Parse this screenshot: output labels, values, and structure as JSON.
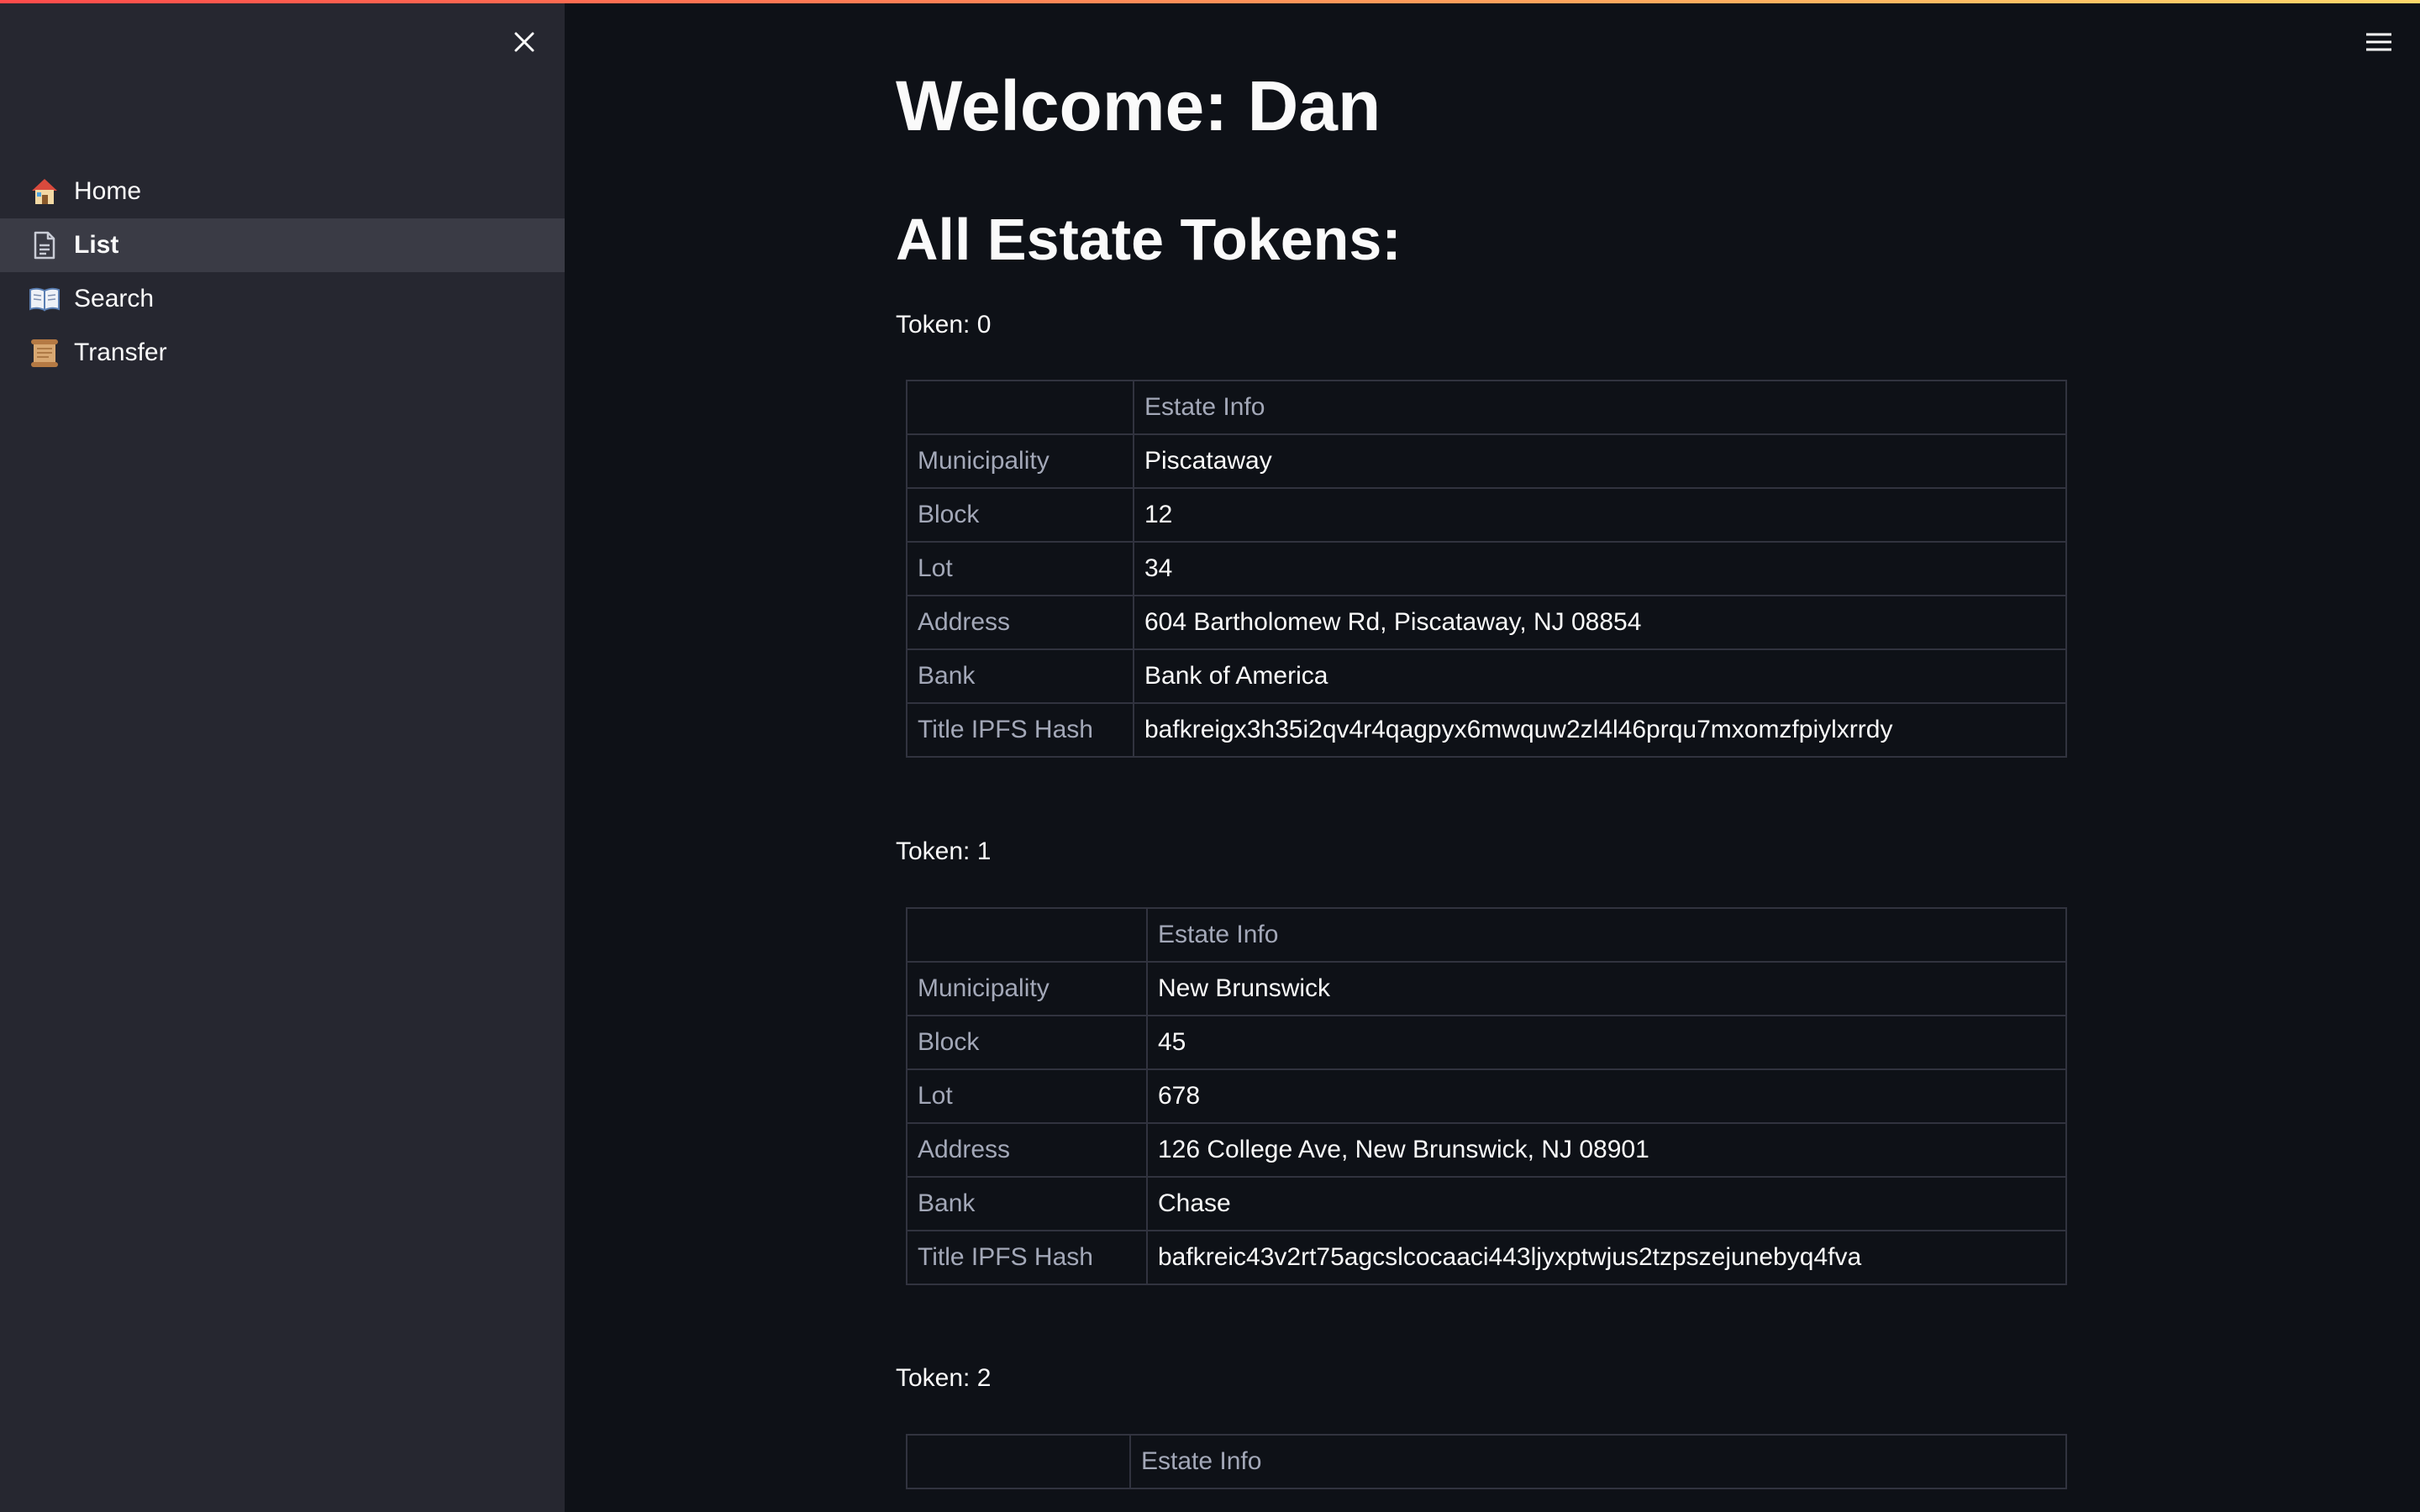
{
  "sidebar": {
    "close_icon": "close-icon",
    "items": [
      {
        "label": "Home",
        "icon": "house-emoji-icon",
        "active": false
      },
      {
        "label": "List",
        "icon": "document-icon",
        "active": true
      },
      {
        "label": "Search",
        "icon": "open-book-emoji-icon",
        "active": false
      },
      {
        "label": "Transfer",
        "icon": "scroll-emoji-icon",
        "active": false
      }
    ]
  },
  "header": {
    "menu_icon": "hamburger-menu-icon"
  },
  "main": {
    "welcome": "Welcome: Dan",
    "section_title": "All Estate Tokens:",
    "table_header": "Estate Info",
    "row_labels": [
      "Municipality",
      "Block",
      "Lot",
      "Address",
      "Bank",
      "Title IPFS Hash"
    ],
    "tokens": [
      {
        "label": "Token: 0",
        "municipality": "Piscataway",
        "block": "12",
        "lot": "34",
        "address": "604 Bartholomew Rd, Piscataway, NJ 08854",
        "bank": "Bank of America",
        "hash": "bafkreigx3h35i2qv4r4qagpyx6mwquw2zl4l46prqu7mxomzfpiylxrrdy"
      },
      {
        "label": "Token: 1",
        "municipality": "New Brunswick",
        "block": "45",
        "lot": "678",
        "address": "126 College Ave, New Brunswick, NJ 08901",
        "bank": "Chase",
        "hash": "bafkreic43v2rt75agcslcocaaci443ljyxptwjus2tzpszejunebyq4fva"
      },
      {
        "label": "Token: 2"
      }
    ]
  },
  "colors": {
    "background": "#0e1117",
    "sidebar": "#262730",
    "active_item": "#3a3b45",
    "table_border": "#31333f",
    "muted_text": "#a3a8b8",
    "accent_gradient_start": "#ff4b4b",
    "accent_gradient_end": "#ffd86b"
  }
}
